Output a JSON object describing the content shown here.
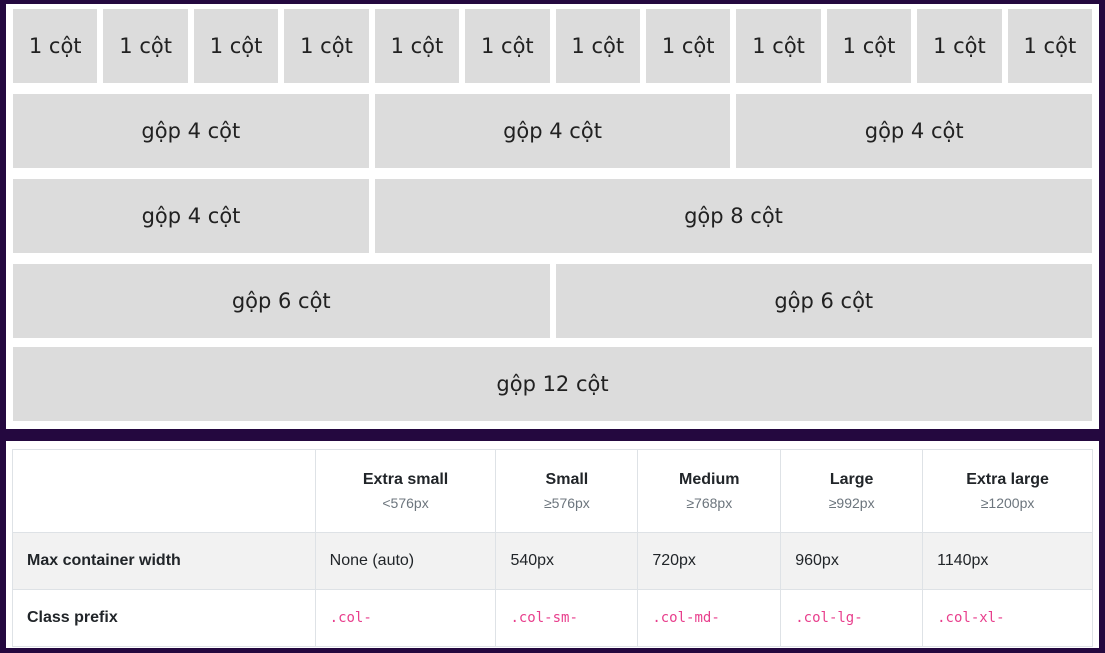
{
  "grid": {
    "rows": [
      [
        "1 cột",
        "1 cột",
        "1 cột",
        "1 cột",
        "1 cột",
        "1 cột",
        "1 cột",
        "1 cột",
        "1 cột",
        "1 cột",
        "1 cột",
        "1 cột"
      ],
      [
        "gộp 4 cột",
        "gộp 4 cột",
        "gộp 4 cột"
      ],
      [
        "gộp 4 cột",
        "gộp 8 cột"
      ],
      [
        "gộp 6 cột",
        "gộp 6 cột"
      ],
      [
        "gộp 12 cột"
      ]
    ]
  },
  "table": {
    "headers": [
      {
        "title": "",
        "sub": ""
      },
      {
        "title": "Extra small",
        "sub": "<576px"
      },
      {
        "title": "Small",
        "sub": "≥576px"
      },
      {
        "title": "Medium",
        "sub": "≥768px"
      },
      {
        "title": "Large",
        "sub": "≥992px"
      },
      {
        "title": "Extra large",
        "sub": "≥1200px"
      }
    ],
    "rows": [
      {
        "label": "Max container width",
        "cells": [
          "None (auto)",
          "540px",
          "720px",
          "960px",
          "1140px"
        ]
      },
      {
        "label": "Class prefix",
        "cells": [
          ".col-",
          ".col-sm-",
          ".col-md-",
          ".col-lg-",
          ".col-xl-"
        ]
      }
    ]
  }
}
